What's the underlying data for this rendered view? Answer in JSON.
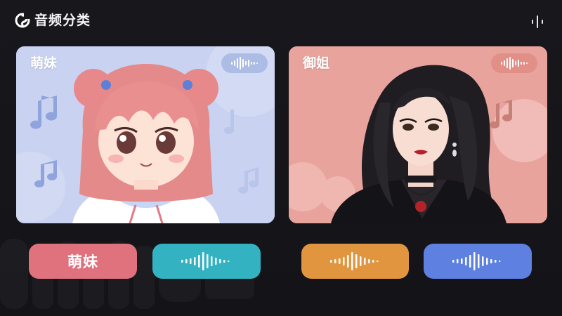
{
  "header": {
    "title": "音频分类",
    "logo_icon": "app-logo-icon",
    "menu_icon": "vertical-wave-menu-icon"
  },
  "cards": [
    {
      "label": "萌妹",
      "bg": "#c9d3f1",
      "wave_icon": "sound-wave-icon"
    },
    {
      "label": "御姐",
      "bg": "#e9a39d",
      "wave_icon": "sound-wave-icon"
    }
  ],
  "buttons": [
    {
      "label": "萌妹",
      "color": "#e0727e"
    },
    {
      "icon": "sound-wave-icon",
      "color": "#33b3c1"
    },
    {
      "icon": "sound-wave-icon",
      "color": "#e2953f"
    },
    {
      "icon": "sound-wave-icon",
      "color": "#5e80e0"
    }
  ]
}
